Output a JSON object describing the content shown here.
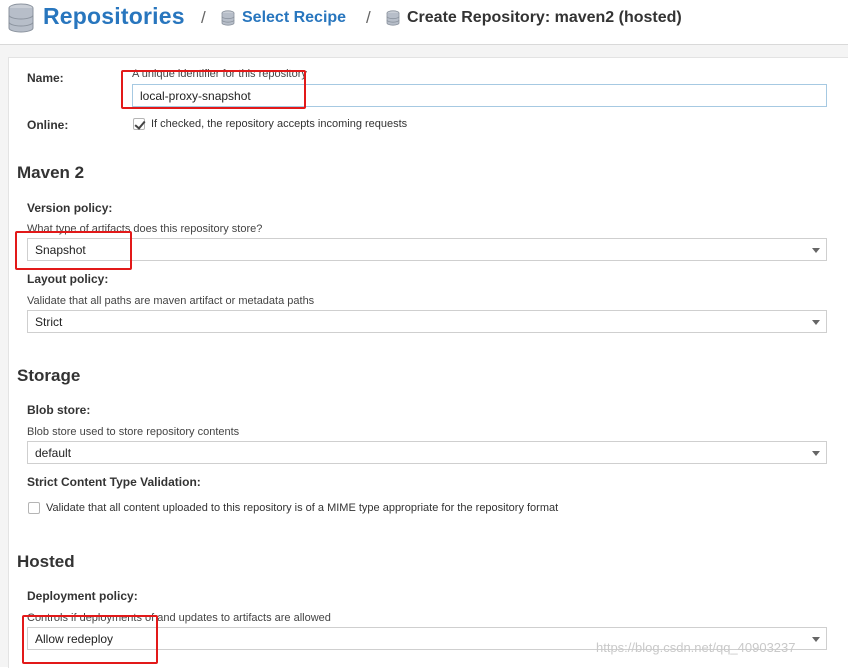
{
  "breadcrumb": {
    "title": "Repositories",
    "separator": "/",
    "link": "Select Recipe",
    "current": "Create Repository: maven2 (hosted)"
  },
  "form": {
    "name": {
      "label": "Name:",
      "help": "A unique identifier for this repository",
      "value": "local-proxy-snapshot"
    },
    "online": {
      "label": "Online:",
      "checked": true,
      "text": "If checked, the repository accepts incoming requests"
    }
  },
  "maven": {
    "heading": "Maven 2",
    "version_policy": {
      "label": "Version policy:",
      "help": "What type of artifacts does this repository store?",
      "value": "Snapshot"
    },
    "layout_policy": {
      "label": "Layout policy:",
      "help": "Validate that all paths are maven artifact or metadata paths",
      "value": "Strict"
    }
  },
  "storage": {
    "heading": "Storage",
    "blob_store": {
      "label": "Blob store:",
      "help": "Blob store used to store repository contents",
      "value": "default"
    },
    "strict_validation": {
      "label": "Strict Content Type Validation:",
      "checked": false,
      "text": "Validate that all content uploaded to this repository is of a MIME type appropriate for the repository format"
    }
  },
  "hosted": {
    "heading": "Hosted",
    "deployment_policy": {
      "label": "Deployment policy:",
      "help": "Controls if deployments of and updates to artifacts are allowed",
      "value": "Allow redeploy"
    }
  },
  "watermark": "https://blog.csdn.net/qq_40903237",
  "colors": {
    "link": "#2876be",
    "annotation": "#e21919",
    "input_border": "#a6c9e2"
  }
}
